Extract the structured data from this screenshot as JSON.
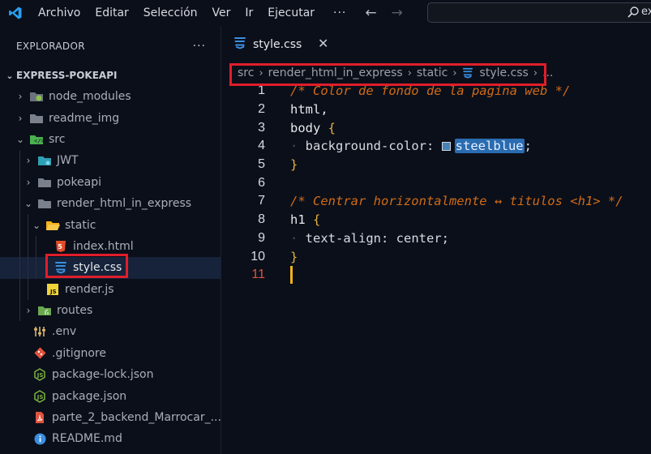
{
  "titlebar": {
    "menu": [
      "Archivo",
      "Editar",
      "Selección",
      "Ver",
      "Ir",
      "Ejecutar"
    ],
    "more": "···",
    "search_text": "ex"
  },
  "sidebar": {
    "title": "EXPLORADOR",
    "more": "···",
    "project": "EXPRESS-POKEAPI",
    "items": [
      {
        "label": "node_modules",
        "icon": "node-folder-icon"
      },
      {
        "label": "readme_img",
        "icon": "folder-icon"
      },
      {
        "label": "src",
        "icon": "src-folder-icon"
      },
      {
        "label": "JWT",
        "icon": "folder-icon"
      },
      {
        "label": "pokeapi",
        "icon": "folder-icon"
      },
      {
        "label": "render_html_in_express",
        "icon": "folder-icon"
      },
      {
        "label": "static",
        "icon": "open-folder-icon"
      },
      {
        "label": "index.html",
        "icon": "html5-icon"
      },
      {
        "label": "style.css",
        "icon": "css3-icon"
      },
      {
        "label": "render.js",
        "icon": "js-icon"
      },
      {
        "label": "routes",
        "icon": "routes-folder-icon"
      },
      {
        "label": ".env",
        "icon": "env-icon"
      },
      {
        "label": ".gitignore",
        "icon": "git-icon"
      },
      {
        "label": "package-lock.json",
        "icon": "nodejs-icon"
      },
      {
        "label": "package.json",
        "icon": "nodejs-icon"
      },
      {
        "label": "parte_2_backend_Marrocar_...",
        "icon": "pdf-icon"
      },
      {
        "label": "README.md",
        "icon": "info-icon"
      }
    ]
  },
  "editor": {
    "tab_label": "style.css",
    "breadcrumb": [
      "src",
      "render_html_in_express",
      "static",
      "style.css",
      "..."
    ],
    "line_numbers": [
      "1",
      "2",
      "3",
      "4",
      "5",
      "6",
      "7",
      "8",
      "9",
      "10",
      "11"
    ],
    "code": {
      "l1": "/* Color de fondo de la pagina web */",
      "l2": "html,",
      "l3_sel": "body",
      "l3_brace": "{",
      "l4_prop": "background-color: ",
      "l4_val": "steelblue",
      "l4_semi": ";",
      "l5": "}",
      "l7": "/* Centrar horizontalmente ↔ titulos <h1> */",
      "l8_sel": "h1",
      "l8_brace": "{",
      "l9_prop": "text-align: ",
      "l9_val": "center",
      "l9_semi": ";",
      "l10": "}"
    }
  },
  "colors": {
    "accent_highlight": "#e01e2a",
    "steelblue_swatch": "#4682b4",
    "comment": "#d06b16",
    "cursor": "#f2b21a"
  }
}
